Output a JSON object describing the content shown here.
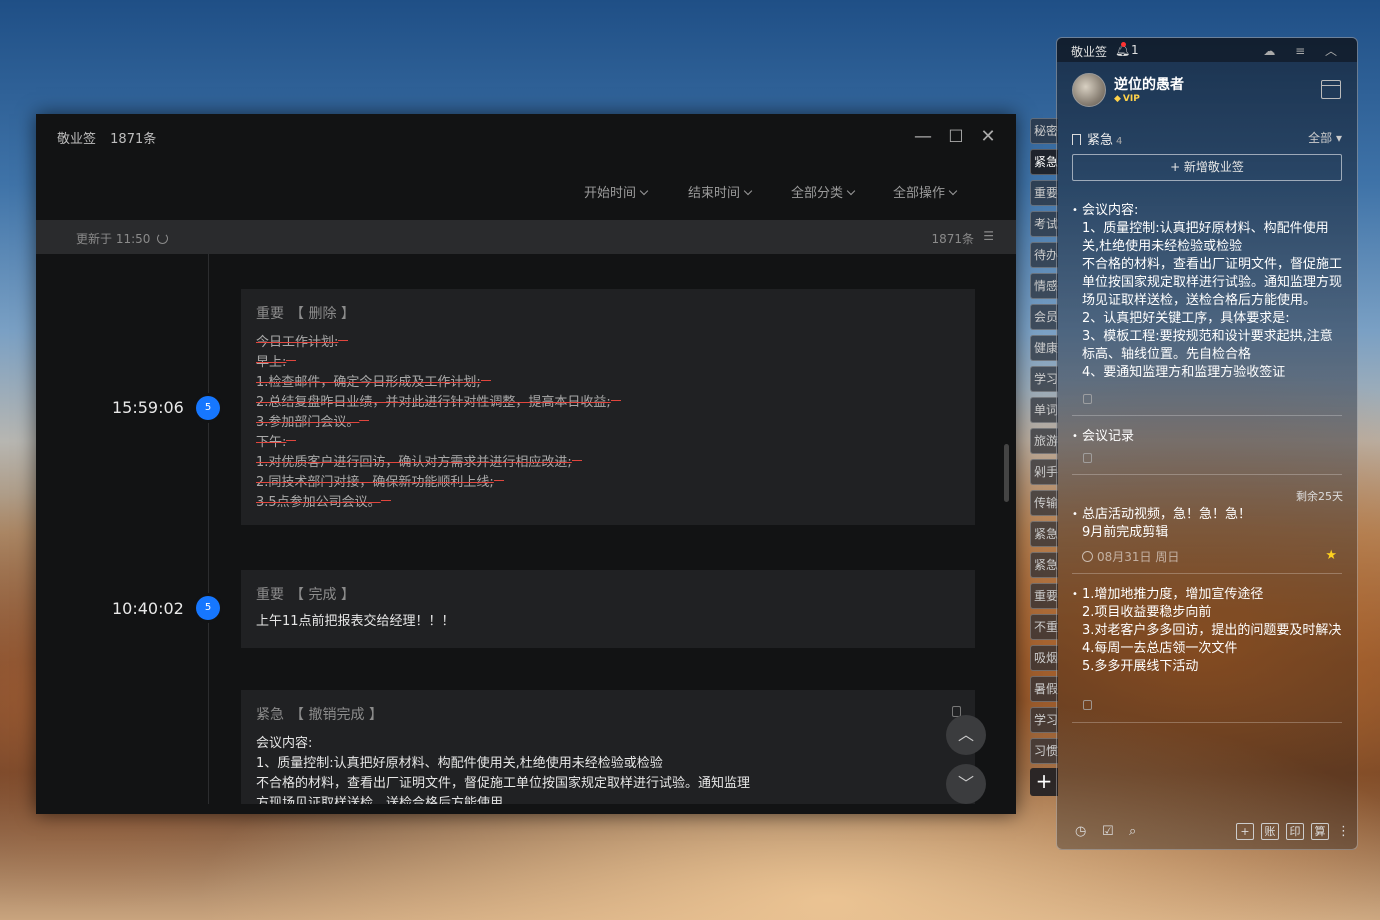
{
  "main_window": {
    "app_name": "敬业签",
    "count_title": "1871条",
    "controls": {
      "minimize": "—",
      "maximize": "☐",
      "close": "✕"
    },
    "filters": [
      "开始时间",
      "结束时间",
      "全部分类",
      "全部操作"
    ],
    "updated_text": "更新于 11:50",
    "total_count": "1871条",
    "entries": [
      {
        "time": "15:59:06",
        "badge": "5",
        "category": "重要",
        "action": "【 删除 】",
        "lines": [
          "今日工作计划:",
          "早上:",
          "1.检查邮件，确定今日形成及工作计划;",
          "2.总结复盘昨日业绩，并对此进行针对性调整，提高本日收益;",
          "3.参加部门会议。",
          "下午:",
          "1.对优质客户进行回访，确认对方需求并进行相应改进;",
          "2.同技术部门对接，确保新功能顺利上线;",
          "3.5点参加公司会议。"
        ]
      },
      {
        "time": "10:40:02",
        "badge": "5",
        "category": "重要",
        "action": "【 完成 】",
        "lines": [
          "上午11点前把报表交给经理！！！"
        ]
      },
      {
        "category": "紧急",
        "action": "【 撤销完成 】",
        "lines": [
          "会议内容:",
          "1、质量控制:认真把好原材料、构配件使用关,杜绝使用未经检验或检验",
          "不合格的材料，查看出厂证明文件，督促施工单位按国家规定取样进行试验。通知监理",
          "方现场见证取样送检，送检合格后方能使用"
        ]
      }
    ],
    "nav": {
      "up": "︿",
      "down": "﹀"
    }
  },
  "category_tabs": [
    "秘密",
    "紧急",
    "重要",
    "考试",
    "待办",
    "情感",
    "会员",
    "健康",
    "学习",
    "单词",
    "旅游",
    "剁手",
    "传输",
    "紧急",
    "紧急",
    "重要",
    "不重",
    "吸烟",
    "暑假",
    "学习",
    "习惯"
  ],
  "category_add": "+",
  "side_panel": {
    "app_name": "敬业签",
    "notify_count": "1",
    "top_icons": "☁ ≡ ︿",
    "user_name": "逆位的愚者",
    "vip_label": "VIP",
    "category": {
      "name": "紧急",
      "count": "4",
      "filter": "全部 ▾"
    },
    "new_button": "+ 新增敬业签",
    "notes": [
      {
        "lines": [
          "会议内容:",
          "1、质量控制:认真把好原材料、构配件使用关,杜绝使用未经检验或检验",
          "不合格的材料，查看出厂证明文件，督促施工单位按国家规定取样进行试验。通知监理方现场见证取样送检，送检合格后方能使用。",
          "2、认真把好关键工序，具体要求是:",
          "3、模板工程:要按规范和设计要求起拱,注意标高、轴线位置。先自检合格",
          "4、要通知监理方和监理方验收签证"
        ]
      },
      {
        "lines": [
          "会议记录"
        ]
      },
      {
        "remain": "剩余25天",
        "lines": [
          "总店活动视频，急！急！急！",
          "9月前完成剪辑"
        ],
        "date": "08月31日 周日"
      },
      {
        "lines": [
          "1.增加地推力度，增加宣传途径",
          "2.项目收益要稳步向前",
          "3.对老客户多多回访，提出的问题要及时解决",
          "4.每周一去总店领一次文件",
          "5.多多开展线下活动"
        ]
      }
    ],
    "bottom_left_icons": [
      "◷",
      "☑",
      "⌕"
    ],
    "bottom_buttons": [
      "+",
      "账",
      "印",
      "算"
    ],
    "more": "⋮"
  }
}
